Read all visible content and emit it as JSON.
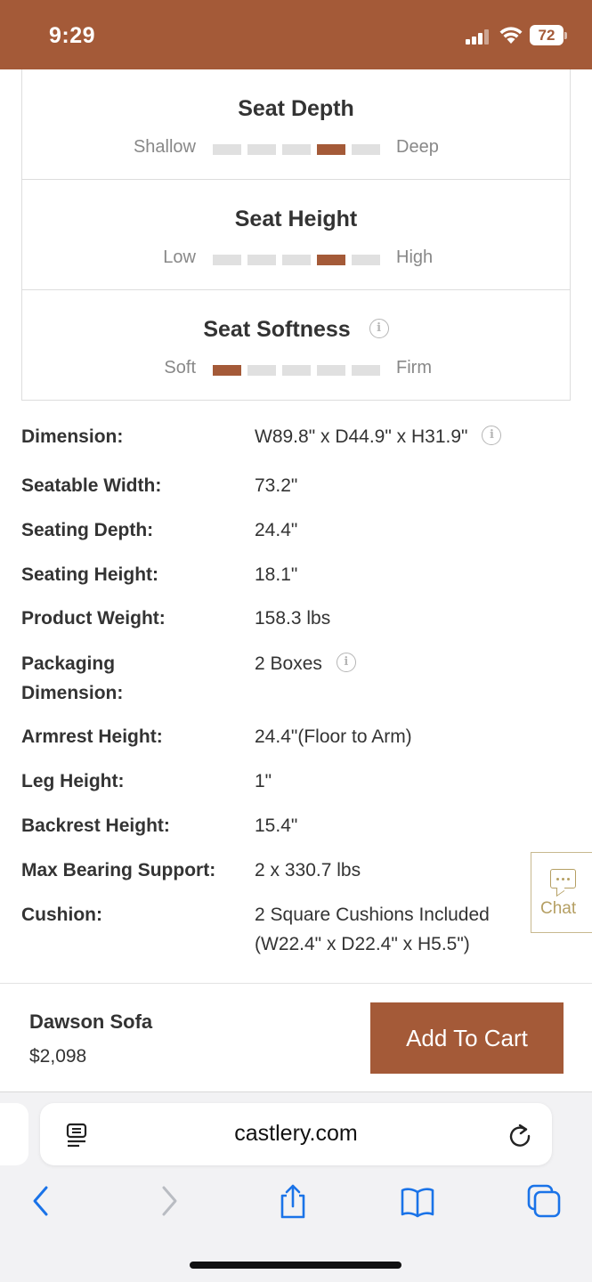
{
  "status_bar": {
    "time": "9:29",
    "battery": "72",
    "icons": [
      "signal-icon",
      "wifi-icon",
      "battery-icon"
    ]
  },
  "ratings": [
    {
      "title": "Seat Depth",
      "left": "Shallow",
      "right": "Deep",
      "level": 4,
      "of": 5,
      "info": false
    },
    {
      "title": "Seat Height",
      "left": "Low",
      "right": "High",
      "level": 4,
      "of": 5,
      "info": false
    },
    {
      "title": "Seat Softness",
      "left": "Soft",
      "right": "Firm",
      "level": 1,
      "of": 5,
      "info": true
    }
  ],
  "specs": [
    {
      "label": "Dimension:",
      "value": "W89.8\" x D44.9\" x H31.9\""
    },
    {
      "label": "Seatable Width:",
      "value": "73.2\""
    },
    {
      "label": "Seating Depth:",
      "value": "24.4\""
    },
    {
      "label": "Seating Height:",
      "value": "18.1\""
    },
    {
      "label": "Product Weight:",
      "value": "158.3 lbs"
    },
    {
      "label_line1": "Packaging",
      "label_line2": "Dimension:",
      "value": "2 Boxes"
    },
    {
      "label": "Armrest Height:",
      "value": "24.4\"(Floor to Arm)"
    },
    {
      "label": "Leg Height:",
      "value": "1\""
    },
    {
      "label": "Backrest Height:",
      "value": "15.4\""
    },
    {
      "label": "Max Bearing Support:",
      "value": "2 x 330.7 lbs"
    },
    {
      "label": "Cushion:",
      "value_line1": "2 Square Cushions Included",
      "value_line2": "(W22.4\" x D22.4\" x H5.5\")"
    }
  ],
  "chat": {
    "label": "Chat"
  },
  "purchase": {
    "product_name": "Dawson Sofa",
    "price": "$2,098",
    "button_label": "Add To Cart"
  },
  "browser": {
    "url": "castlery.com"
  },
  "colors": {
    "brand": "#a45a38",
    "chat_gold": "#b59f63",
    "safari_blue": "#1a73e8"
  }
}
